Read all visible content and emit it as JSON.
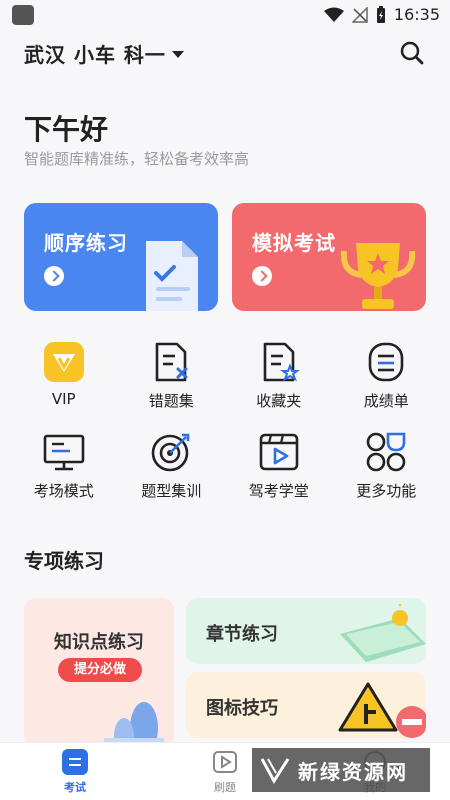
{
  "status_bar": {
    "time": "16:35"
  },
  "header": {
    "location": "武汉 小车 科一"
  },
  "greeting": {
    "title": "下午好",
    "subtitle": "智能题库精准练，轻松备考效率高"
  },
  "main_cards": [
    {
      "label": "顺序练习",
      "color": "#4a86f0"
    },
    {
      "label": "模拟考试",
      "color": "#f26a6d"
    }
  ],
  "grid": [
    {
      "label": "VIP",
      "icon": "vip-icon"
    },
    {
      "label": "错题集",
      "icon": "wrong-questions-icon"
    },
    {
      "label": "收藏夹",
      "icon": "favorites-icon"
    },
    {
      "label": "成绩单",
      "icon": "transcript-icon"
    },
    {
      "label": "考场模式",
      "icon": "exam-room-icon"
    },
    {
      "label": "题型集训",
      "icon": "target-icon"
    },
    {
      "label": "驾考学堂",
      "icon": "video-class-icon"
    },
    {
      "label": "更多功能",
      "icon": "more-grid-icon"
    }
  ],
  "special": {
    "title": "专项练习",
    "knowledge": {
      "title": "知识点练习",
      "badge": "提分必做"
    },
    "chapter": {
      "title": "章节练习"
    },
    "signs": {
      "title": "图标技巧"
    }
  },
  "tabs": [
    {
      "label": "考试",
      "active": true
    },
    {
      "label": "刷题",
      "active": false
    },
    {
      "label": "我的",
      "active": false
    }
  ],
  "watermark": {
    "text": "新绿资源网"
  },
  "colors": {
    "accent": "#2e6fe8",
    "vip": "#f7c325"
  }
}
